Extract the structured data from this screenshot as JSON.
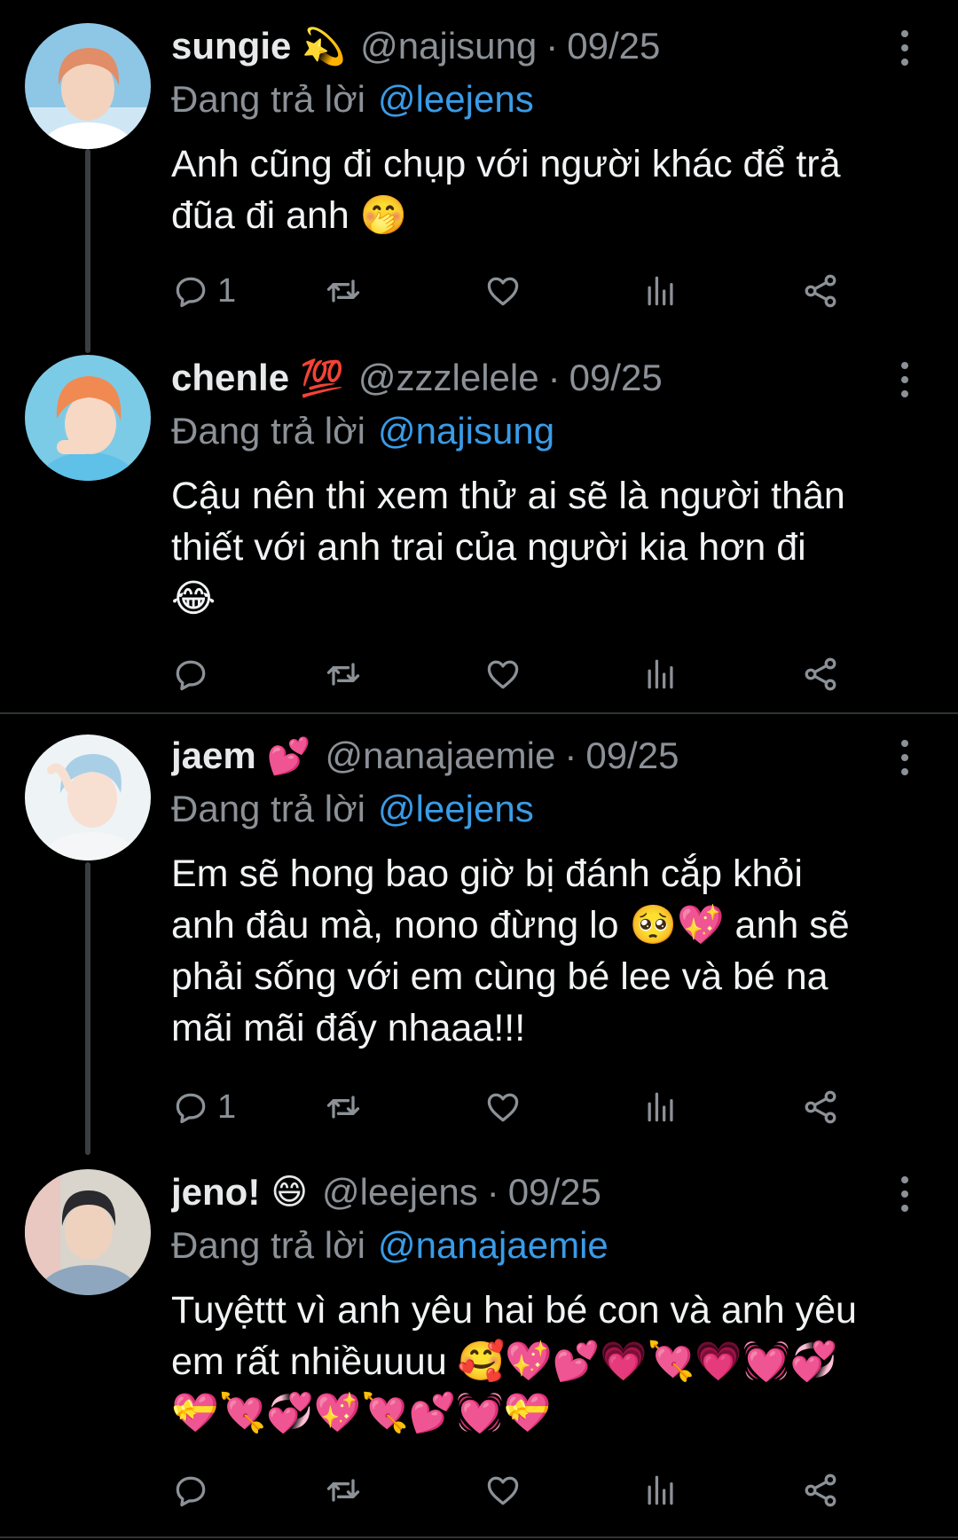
{
  "tweets": [
    {
      "display_name": "sungie",
      "name_emoji": "💫",
      "handle": "@najisung",
      "date": "09/25",
      "reply_label": "Đang trả lời",
      "reply_to": "@leejens",
      "lines": [
        "Anh cũng đi chụp với người khác để trả",
        "đũa đi anh 🤭"
      ],
      "reply_count": "1",
      "avatar_colors": {
        "bg": "#8ec6e6",
        "hair": "#e08d68",
        "skin": "#f3d3bd",
        "shirt": "#ffffff"
      }
    },
    {
      "display_name": "chenle",
      "name_emoji": "💯",
      "handle": "@zzzlelele",
      "date": "09/25",
      "reply_label": "Đang trả lời",
      "reply_to": "@najisung",
      "lines": [
        "Cậu nên thi xem thử ai sẽ là người thân",
        "thiết với anh trai của người kia hơn đi",
        "😂"
      ],
      "reply_count": "",
      "avatar_colors": {
        "bg": "#7ccbe6",
        "hair": "#f08a52",
        "skin": "#f6d8c4",
        "shirt": "#5fc0e8"
      }
    },
    {
      "display_name": "jaem",
      "name_emoji": "💕",
      "handle": "@nanajaemie",
      "date": "09/25",
      "reply_label": "Đang trả lời",
      "reply_to": "@leejens",
      "lines": [
        "Em sẽ hong bao giờ bị đánh cắp khỏi",
        "anh đâu mà, nono đừng lo 🥺💖 anh sẽ",
        "phải sống với em cùng bé lee và bé na",
        "mãi mãi đấy nhaaa!!!"
      ],
      "reply_count": "1",
      "avatar_colors": {
        "bg": "#eef3f6",
        "hair": "#a9cfe6",
        "skin": "#f7e0d2",
        "shirt": "#f4f6f8"
      }
    },
    {
      "display_name": "jeno!",
      "name_emoji": "😄",
      "handle": "@leejens",
      "date": "09/25",
      "reply_label": "Đang trả lời",
      "reply_to": "@nanajaemie",
      "lines": [
        "Tuyệttt vì anh yêu hai bé con và anh yêu",
        "em rất nhiềuuuu 🥰💖💕💗💘💗💓💞",
        "💝💘💞💖💘💕💓💝"
      ],
      "reply_count": "",
      "avatar_colors": {
        "bg": "#d9d4cc",
        "hair": "#2a2a2e",
        "skin": "#efd2bd",
        "shirt": "#8ea6be"
      }
    }
  ],
  "theme": {
    "background": "#000000",
    "link": "#3a9be6",
    "muted": "#8b9197",
    "thread_line": "#3a3d42"
  },
  "icons": [
    "reply-icon",
    "retweet-icon",
    "like-icon",
    "views-icon",
    "share-icon",
    "more-icon"
  ]
}
